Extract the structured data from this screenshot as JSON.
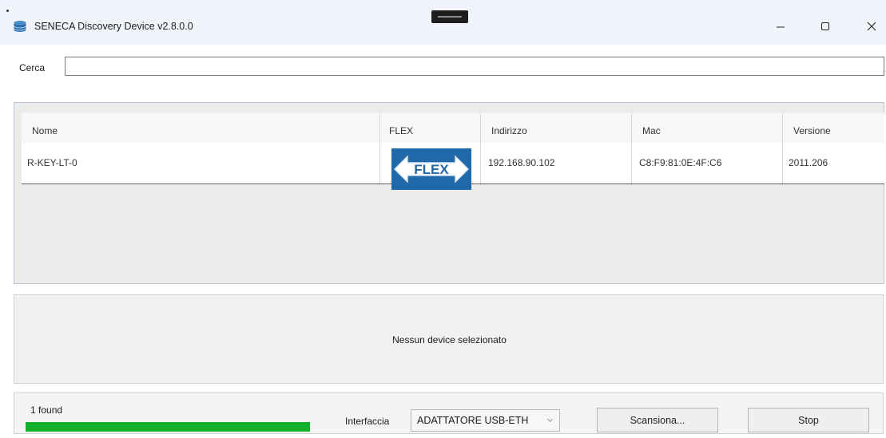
{
  "window": {
    "title": "SENECA Discovery Device v2.8.0.0"
  },
  "search": {
    "label": "Cerca",
    "value": "",
    "placeholder": ""
  },
  "grid": {
    "columns": [
      "Nome",
      "FLEX",
      "Indirizzo",
      "Mac",
      "Versione"
    ],
    "rows": [
      {
        "nome": "R-KEY-LT-0",
        "flex_logo_text": "FLEX",
        "indirizzo": "192.168.90.102",
        "mac": "C8:F9:81:0E:4F:C6",
        "versione": "2011.206"
      }
    ]
  },
  "detail": {
    "message": "Nessun device selezionato"
  },
  "status": {
    "found_text": "1 found",
    "progress_fraction": 1.0,
    "progress_color": "#10b02a",
    "interface_label": "Interfaccia",
    "interface_value": "ADATTATORE USB-ETH",
    "scan_button": "Scansiona...",
    "stop_button": "Stop"
  },
  "icons": {
    "app": "database-icon",
    "minimize": "minimize-icon",
    "maximize": "maximize-icon",
    "close": "close-icon"
  }
}
